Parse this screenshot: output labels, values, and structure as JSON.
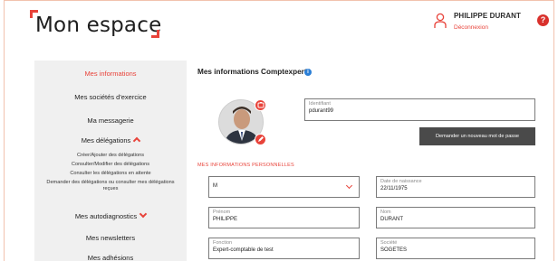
{
  "header": {
    "logo_text": "Mon espace",
    "user_name": "PHILIPPE DURANT",
    "logout_label": "Déconnexion",
    "help_label": "?"
  },
  "sidebar": {
    "items": [
      {
        "label": "Mes informations",
        "active": true
      },
      {
        "label": "Mes sociétés d'exercice"
      },
      {
        "label": "Ma messagerie"
      },
      {
        "label": "Mes délégations"
      },
      {
        "label": "Mes autodiagnostics"
      },
      {
        "label": "Mes newsletters"
      },
      {
        "label": "Mes adhésions"
      }
    ],
    "delegation_subitems": [
      "Créer/Ajouter des délégations",
      "Consulter/Modifier des délégations",
      "Consulter les délégations en attente",
      "Demander des délégations ou consulter mes délégations reçues"
    ]
  },
  "main": {
    "title": "Mes informations Comptexpert",
    "info_icon": "i",
    "identifier": {
      "label": "Identifiant",
      "value": "pdurant99"
    },
    "change_password_label": "Demander un nouveau mot de passe",
    "section_label": "MES INFORMATIONS PERSONNELLES",
    "civility": {
      "value": "M"
    },
    "birthdate": {
      "label": "Date de naissance",
      "value": "22/11/1975"
    },
    "firstname": {
      "label": "Prénom",
      "value": "PHILIPPE"
    },
    "lastname": {
      "label": "Nom",
      "value": "DURANT"
    },
    "function": {
      "label": "Fonction",
      "value": "Expert-comptable de test"
    },
    "company": {
      "label": "Société",
      "value": "SOGETES"
    }
  },
  "colors": {
    "accent": "#e8433a",
    "sidebar_bg": "#f0f0f0",
    "button_bg": "#4a4a4a",
    "info_blue": "#2c7fd6"
  }
}
